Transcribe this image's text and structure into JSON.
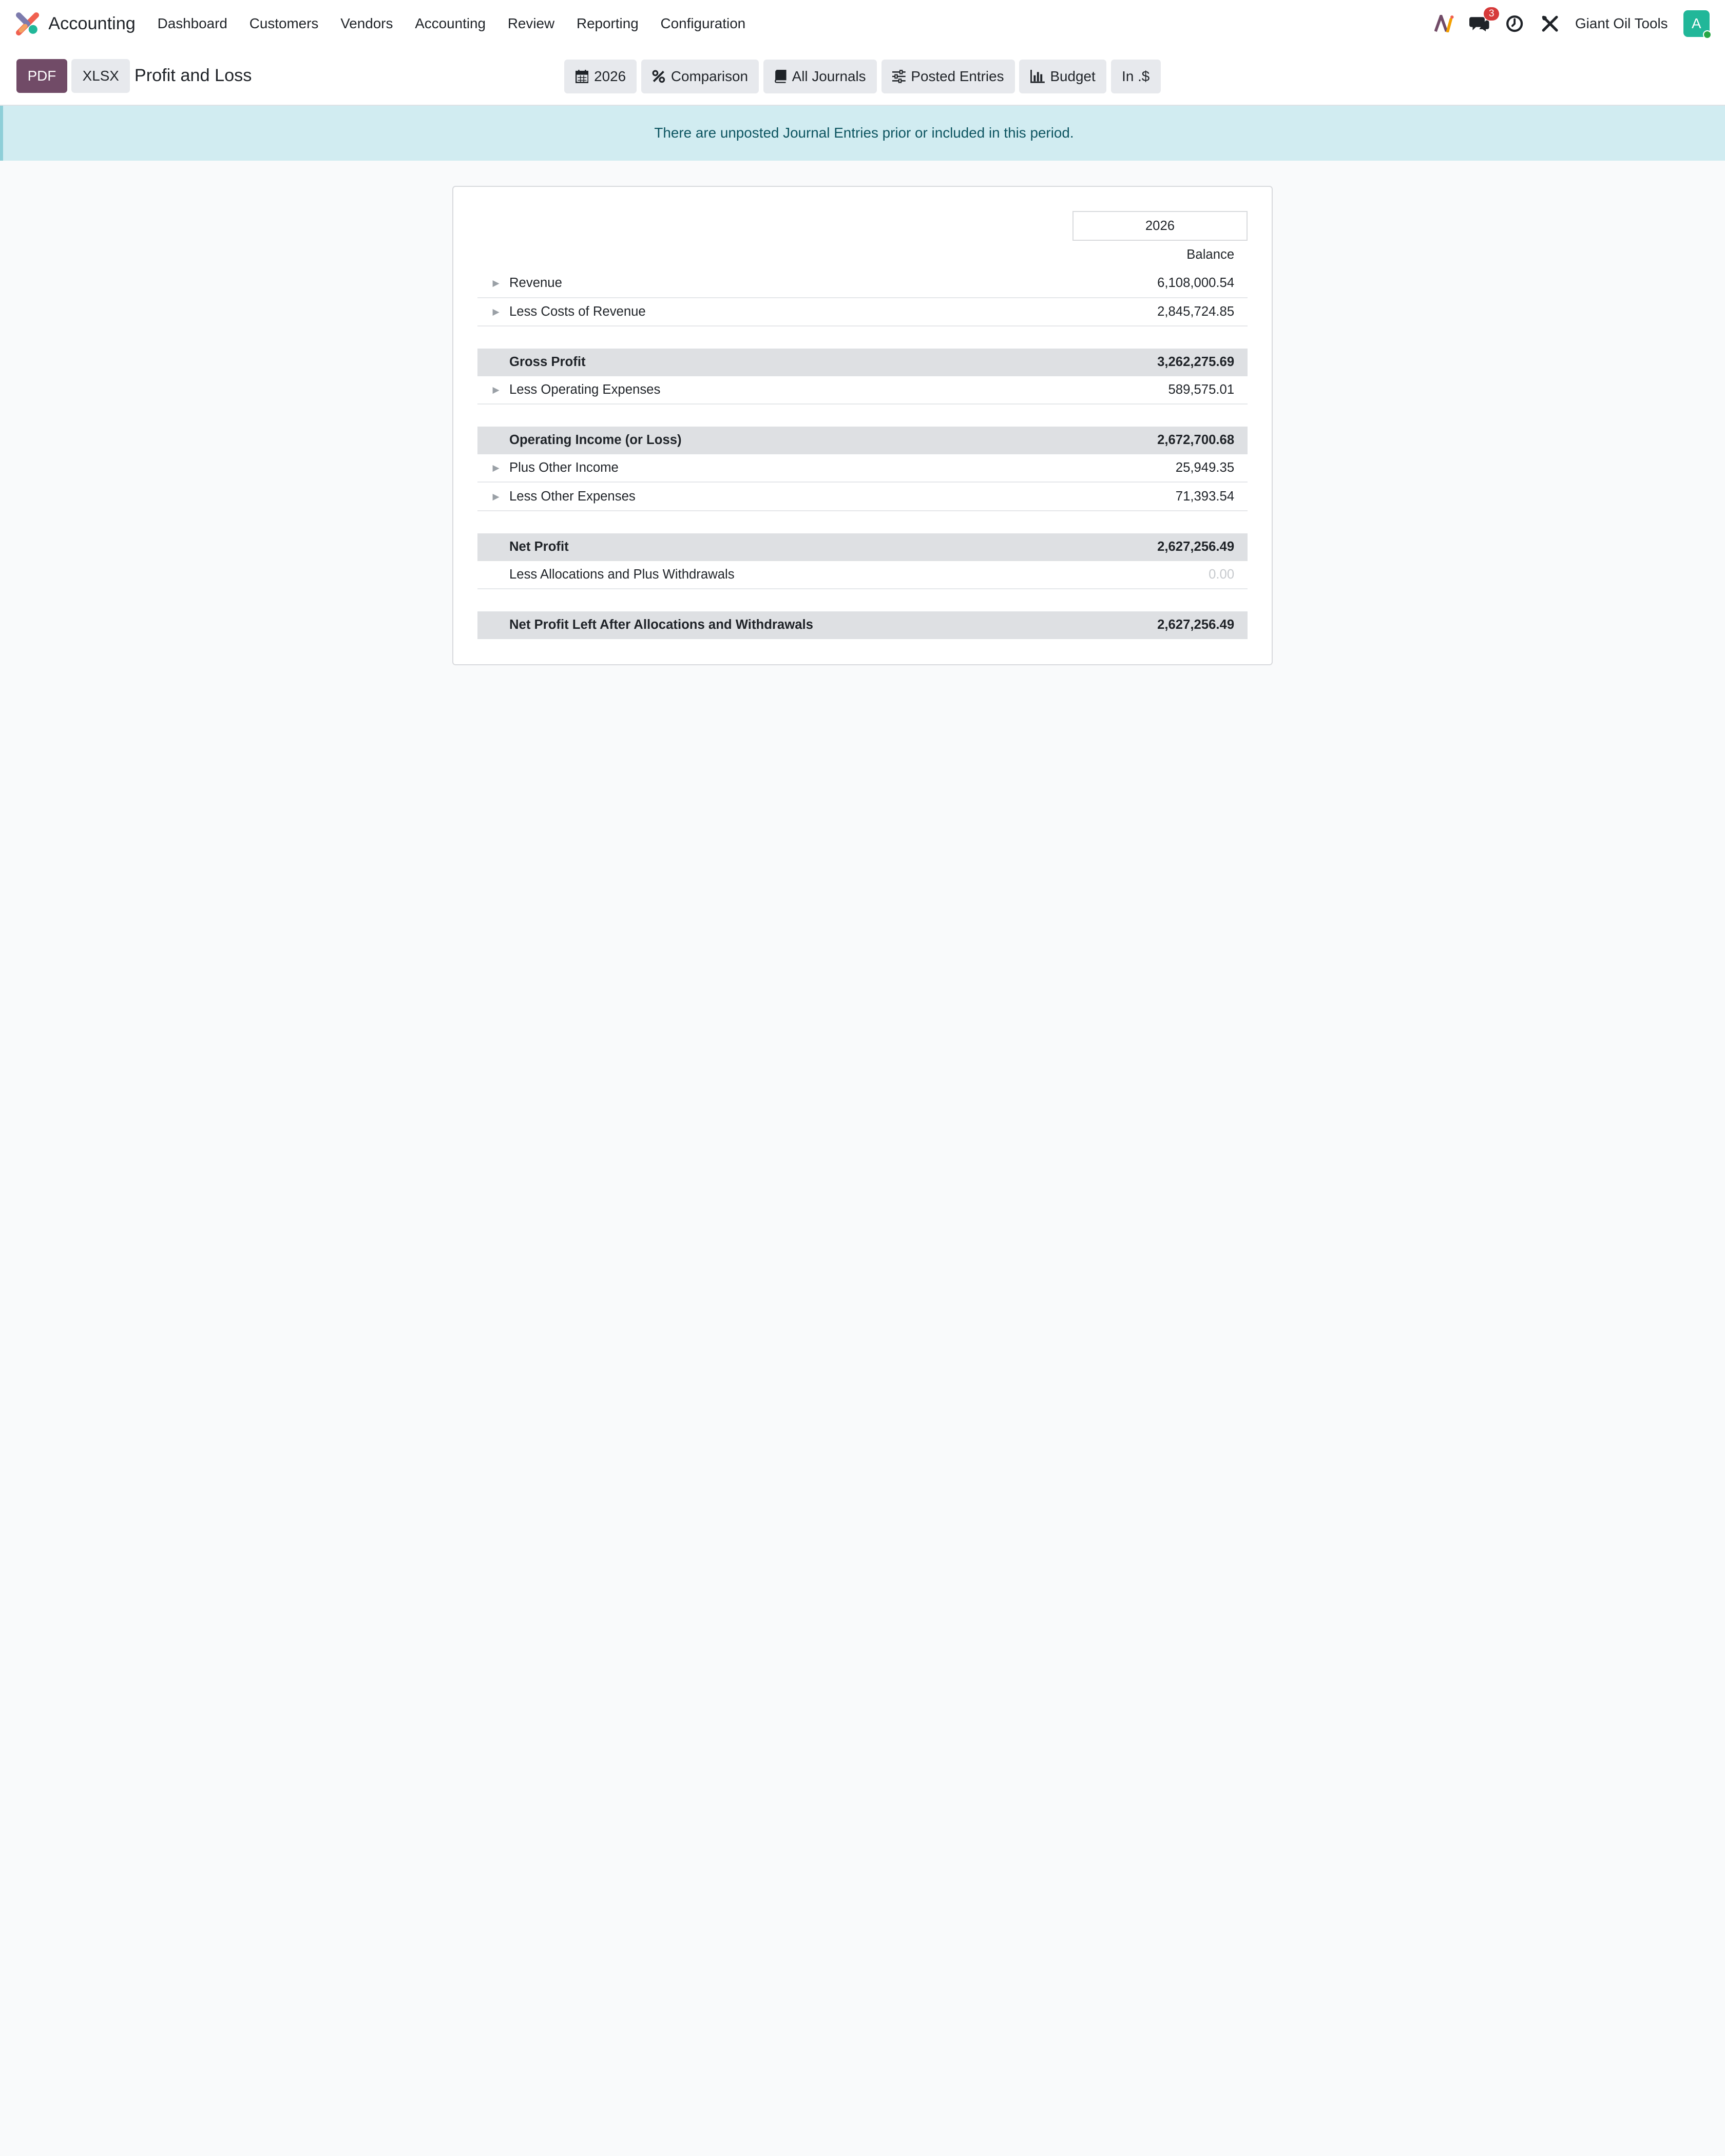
{
  "navbar": {
    "app_name": "Accounting",
    "menu": [
      "Dashboard",
      "Customers",
      "Vendors",
      "Accounting",
      "Review",
      "Reporting",
      "Configuration"
    ],
    "messages_badge": "3",
    "company": "Giant Oil Tools",
    "avatar_letter": "A"
  },
  "control_panel": {
    "pdf_label": "PDF",
    "xlsx_label": "XLSX",
    "title": "Profit and Loss",
    "filters": {
      "period": "2026",
      "comparison": "Comparison",
      "journals": "All Journals",
      "entries": "Posted Entries",
      "budget": "Budget",
      "currency": "In .$"
    }
  },
  "alert": {
    "message": "There are unposted Journal Entries prior or included in this period."
  },
  "report": {
    "period_header": "2026",
    "column_header": "Balance",
    "rows": [
      {
        "label": "Revenue",
        "amount": "6,108,000.54"
      },
      {
        "label": "Less Costs of Revenue",
        "amount": "2,845,724.85"
      },
      {
        "label": "Gross Profit",
        "amount": "3,262,275.69"
      },
      {
        "label": "Less Operating Expenses",
        "amount": "589,575.01"
      },
      {
        "label": "Operating Income (or Loss)",
        "amount": "2,672,700.68"
      },
      {
        "label": "Plus Other Income",
        "amount": "25,949.35"
      },
      {
        "label": "Less Other Expenses",
        "amount": "71,393.54"
      },
      {
        "label": "Net Profit",
        "amount": "2,627,256.49"
      },
      {
        "label": "Less Allocations and Plus Withdrawals",
        "amount": "0.00"
      },
      {
        "label": "Net Profit Left After Allocations and Withdrawals",
        "amount": "2,627,256.49"
      }
    ]
  },
  "colors": {
    "primary": "#714b67",
    "alert_bg": "#d1ecf1",
    "total_row_bg": "#dee0e3",
    "badge": "#d63a3a",
    "avatar": "#21b799"
  },
  "icons": [
    "app-logo-icon",
    "ai-icon",
    "messages-icon",
    "activity-clock-icon",
    "tools-icon",
    "calendar-icon",
    "percent-icon",
    "book-icon",
    "sliders-icon",
    "bar-chart-icon",
    "caret-right-icon"
  ]
}
